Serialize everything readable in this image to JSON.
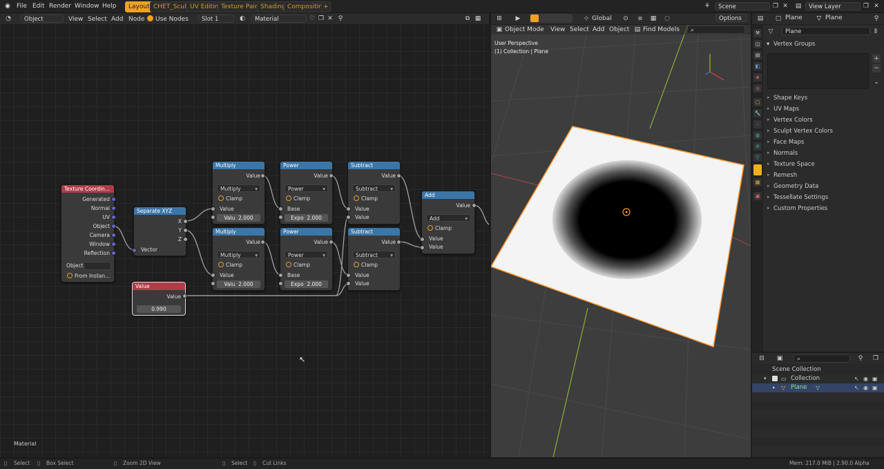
{
  "menu": [
    "File",
    "Edit",
    "Render",
    "Window",
    "Help"
  ],
  "workspaces": [
    "Layout",
    "CHET_Sculpt",
    "UV Editing",
    "Texture Paint",
    "Shading",
    "Compositing"
  ],
  "workspace_add": "+",
  "scene_name": "Scene",
  "view_layer": "View Layer",
  "node_editor": {
    "mode": "Object",
    "menus": [
      "View",
      "Select",
      "Add",
      "Node"
    ],
    "use_nodes": "Use Nodes",
    "slot": "Slot 1",
    "material": "Material",
    "footer_label": "Material",
    "nodes": {
      "texcoord": {
        "title": "Texture Coordin...",
        "outputs": [
          "Generated",
          "Normal",
          "UV",
          "Object",
          "Camera",
          "Window",
          "Reflection"
        ],
        "object_label": "Object:",
        "from_instancer": "From Instan..."
      },
      "separate": {
        "title": "Separate XYZ",
        "outputs": [
          "X",
          "Y",
          "Z"
        ],
        "input": "Vector"
      },
      "multiply1": {
        "title": "Multiply",
        "output": "Value",
        "op": "Multiply",
        "clamp": "Clamp",
        "input": "Value",
        "field_label": "Valu",
        "field_value": "2.000"
      },
      "multiply2": {
        "title": "Multiply",
        "output": "Value",
        "op": "Multiply",
        "clamp": "Clamp",
        "input": "Value",
        "field_label": "Valu",
        "field_value": "2.000"
      },
      "power1": {
        "title": "Power",
        "output": "Value",
        "op": "Power",
        "clamp": "Clamp",
        "input": "Base",
        "field_label": "Expo",
        "field_value": "2.000"
      },
      "power2": {
        "title": "Power",
        "output": "Value",
        "op": "Power",
        "clamp": "Clamp",
        "input": "Base",
        "field_label": "Expo",
        "field_value": "2.000"
      },
      "subtract1": {
        "title": "Subtract",
        "output": "Value",
        "op": "Subtract",
        "clamp": "Clamp",
        "input1": "Value",
        "input2": "Value"
      },
      "subtract2": {
        "title": "Subtract",
        "output": "Value",
        "op": "Subtract",
        "clamp": "Clamp",
        "input1": "Value",
        "input2": "Value"
      },
      "add": {
        "title": "Add",
        "output": "Value",
        "op": "Add",
        "clamp": "Clamp",
        "input1": "Value",
        "input2": "Value"
      },
      "value": {
        "title": "Value",
        "output": "Value",
        "field_value": "0.990"
      }
    }
  },
  "viewport": {
    "orientation": "Global",
    "options": "Options",
    "mode": "Object Mode",
    "menus": [
      "View",
      "Select",
      "Add",
      "Object"
    ],
    "find_models": "Find Models",
    "overlay_title": "User Perspective",
    "overlay_sub": "(1) Collection | Plane"
  },
  "properties": {
    "header_object": "Plane",
    "header_data": "Plane",
    "data_name": "Plane",
    "vertex_groups": "Vertex Groups",
    "panels": [
      "Shape Keys",
      "UV Maps",
      "Vertex Colors",
      "Sculpt Vertex Colors",
      "Face Maps",
      "Normals",
      "Texture Space",
      "Remesh",
      "Geometry Data",
      "Tessellate Settings",
      "Custom Properties"
    ]
  },
  "outliner": {
    "scene_collection": "Scene Collection",
    "collection": "Collection",
    "object": "Plane"
  },
  "statusbar": {
    "items": [
      "Select",
      "Box Select",
      "Zoom 2D View",
      "Select",
      "Cut Links"
    ],
    "mem": "Mem: 217.0 MiB | 2.90.0 Alpha"
  },
  "colors": {
    "accent": "#f0a023",
    "node_blue": "#3b76a8",
    "node_red": "#b03c48",
    "selected": "#ff9a33"
  }
}
